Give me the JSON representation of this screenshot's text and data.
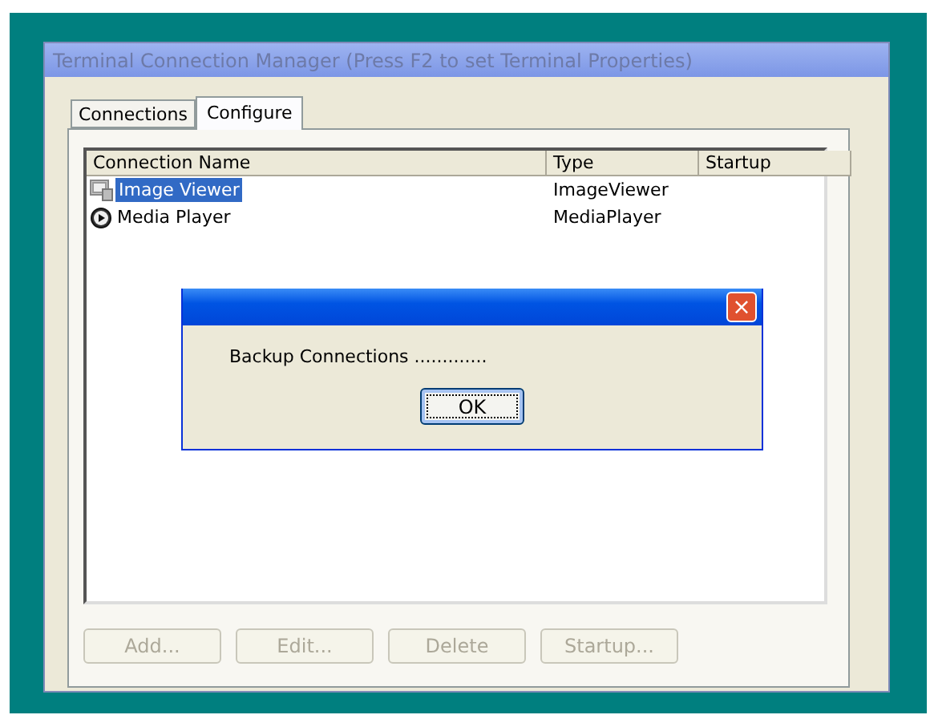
{
  "window": {
    "title": "Terminal Connection Manager (Press F2 to set Terminal Properties)",
    "active": false
  },
  "tabs": [
    {
      "label": "Connections",
      "selected": false
    },
    {
      "label": "Configure",
      "selected": true
    }
  ],
  "table": {
    "columns": [
      "Connection Name",
      "Type",
      "Startup"
    ],
    "rows": [
      {
        "kind": "image",
        "name": "Image Viewer",
        "type": "ImageViewer",
        "selected": true
      },
      {
        "kind": "media",
        "name": "Media Player",
        "type": "MediaPlayer",
        "selected": false
      }
    ]
  },
  "buttons": [
    {
      "label": "Add...",
      "disabled": true
    },
    {
      "label": "Edit...",
      "disabled": true
    },
    {
      "label": "Delete",
      "disabled": true
    },
    {
      "label": "Startup...",
      "disabled": true
    }
  ],
  "dialog": {
    "message": "Backup Connections .............",
    "close": "×",
    "button": "OK"
  }
}
